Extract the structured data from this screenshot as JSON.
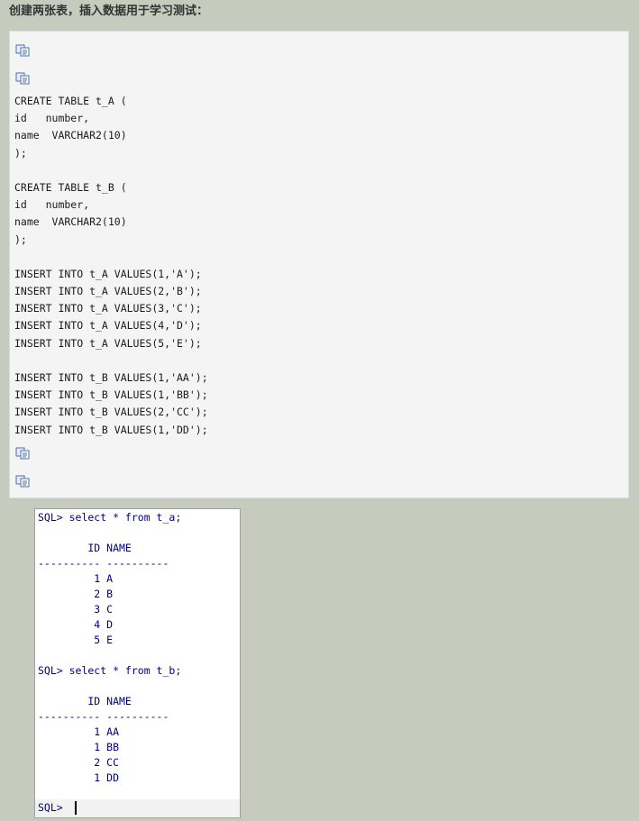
{
  "heading": "创建两张表，插入数据用于学习测试：",
  "code": {
    "icons": [
      "copy-icon",
      "copy-icon",
      "copy-icon",
      "copy-icon"
    ],
    "lines": [
      "CREATE TABLE t_A (",
      "id   number,",
      "name  VARCHAR2(10)",
      ");",
      "",
      "CREATE TABLE t_B (",
      "id   number,",
      "name  VARCHAR2(10)",
      ");",
      "",
      "INSERT INTO t_A VALUES(1,'A');",
      "INSERT INTO t_A VALUES(2,'B');",
      "INSERT INTO t_A VALUES(3,'C');",
      "INSERT INTO t_A VALUES(4,'D');",
      "INSERT INTO t_A VALUES(5,'E');",
      "",
      "INSERT INTO t_B VALUES(1,'AA');",
      "INSERT INTO t_B VALUES(1,'BB');",
      "INSERT INTO t_B VALUES(2,'CC');",
      "INSERT INTO t_B VALUES(1,'DD');"
    ]
  },
  "console": {
    "lines": [
      "SQL> select * from t_a;",
      "",
      "        ID NAME",
      "---------- ----------",
      "         1 A",
      "         2 B",
      "         3 C",
      "         4 D",
      "         5 E",
      "",
      "SQL> select * from t_b;",
      "",
      "        ID NAME",
      "---------- ----------",
      "         1 AA",
      "         1 BB",
      "         2 CC",
      "         1 DD"
    ],
    "prompt": "SQL> "
  }
}
